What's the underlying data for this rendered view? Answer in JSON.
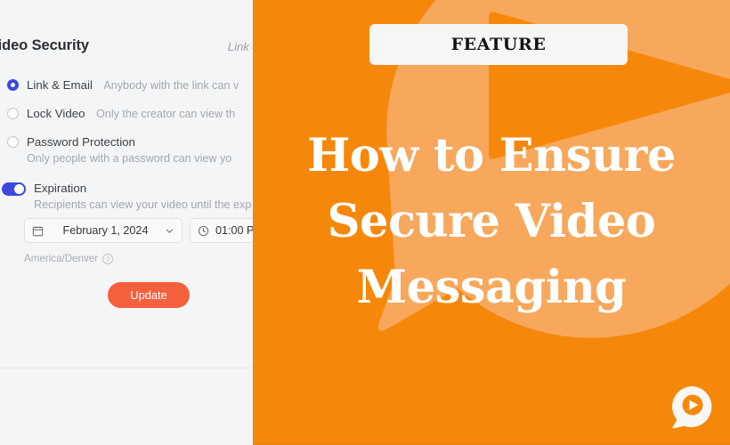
{
  "left_panel": {
    "title": "Video Security",
    "subtitle": "Link &",
    "options": [
      {
        "id": "link-email",
        "label": "Link & Email",
        "description": "Anybody with the link can v",
        "control": "radio",
        "selected": true
      },
      {
        "id": "lock-video",
        "label": "Lock Video",
        "description": "Only the creator can view th",
        "control": "radio",
        "selected": false
      },
      {
        "id": "password-protection",
        "label": "Password Protection",
        "description": "Only people with a password can view yo",
        "control": "radio",
        "selected": false
      },
      {
        "id": "expiration",
        "label": "Expiration",
        "description": "Recipients can view your video until the exp",
        "control": "toggle",
        "selected": true
      }
    ],
    "date_field": {
      "icon": "calendar-icon",
      "value": "February 1, 2024",
      "chevron": "chevron-down-icon"
    },
    "time_field": {
      "icon": "clock-icon",
      "value": "01:00 P"
    },
    "timezone": {
      "label": "America/Denver",
      "help_icon": "question-mark-icon"
    },
    "update_button": {
      "label": "Update",
      "color": "#f4603e"
    }
  },
  "right_panel": {
    "badge": "FEATURE",
    "headline_lines": [
      "How to Ensure",
      "Secure Video",
      "Messaging"
    ],
    "logo": "vidyard-play-bubble-logo",
    "colors": {
      "background": "#f5880b",
      "accent_light": "#f7a85c",
      "badge_background": "#f6f6f4",
      "text": "#ffffff"
    }
  }
}
